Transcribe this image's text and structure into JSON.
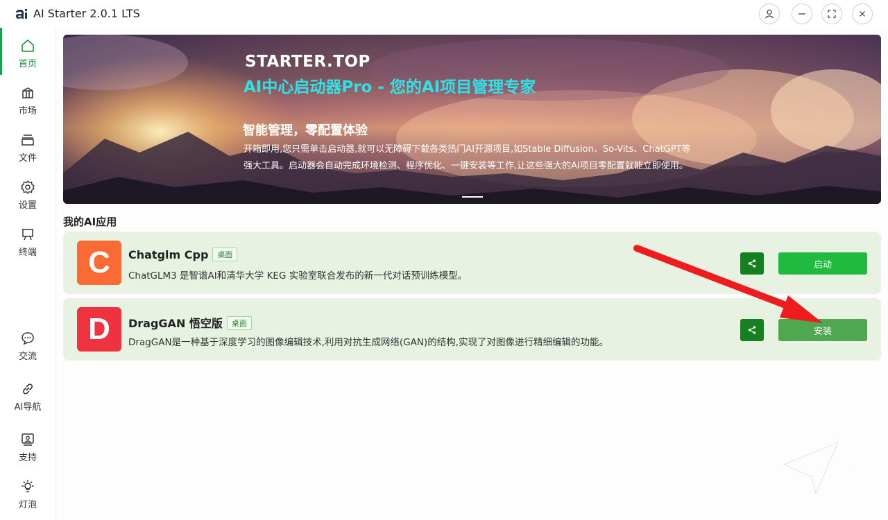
{
  "window": {
    "title": "AI Starter 2.0.1 LTS",
    "logo_text": "ai"
  },
  "sidebar": {
    "top_items": [
      {
        "label": "首页",
        "icon": "home-icon",
        "active": true
      },
      {
        "label": "市场",
        "icon": "market-icon"
      },
      {
        "label": "文件",
        "icon": "files-icon"
      },
      {
        "label": "设置",
        "icon": "gear-icon"
      },
      {
        "label": "终端",
        "icon": "terminal-icon"
      }
    ],
    "bottom_items": [
      {
        "label": "交流",
        "icon": "chat-icon"
      },
      {
        "label": "AI导航",
        "icon": "link-icon"
      },
      {
        "label": "支持",
        "icon": "support-icon"
      },
      {
        "label": "灯泡",
        "icon": "bulb-icon"
      }
    ]
  },
  "banner": {
    "brand": "STARTER.TOP",
    "headline": "AI中心启动器Pro - 您的AI项目管理专家",
    "subtitle": "智能管理，零配置体验",
    "description": "开箱即用,您只需单击启动器,就可以无障碍下载各类热门AI开源项目,如Stable Diffusion、So-Vits、ChatGPT等强大工具。启动器会自动完成环境检测、程序优化、一键安装等工作,让这些强大的AI项目零配置就能立即使用。"
  },
  "section": {
    "title": "我的AI应用"
  },
  "apps": [
    {
      "letter": "C",
      "name": "Chatglm Cpp",
      "tag": "桌面",
      "description": "ChatGLM3 是智谱AI和清华大学 KEG 实验室联合发布的新一代对话预训练模型。",
      "action_label": "启动",
      "icon_color": "#fa6a34",
      "action_color": "#1fba3f"
    },
    {
      "letter": "D",
      "name": "DragGAN 悟空版",
      "tag": "桌面",
      "description": "DragGAN是一种基于深度学习的图像编辑技术,利用对抗生成网络(GAN)的结构,实现了对图像进行精细编辑的功能。",
      "action_label": "安装",
      "icon_color": "#ef3240",
      "action_color": "#4fa84f"
    }
  ],
  "colors": {
    "accent": "#1aa34a",
    "annotation_arrow": "#ee1c1c"
  }
}
